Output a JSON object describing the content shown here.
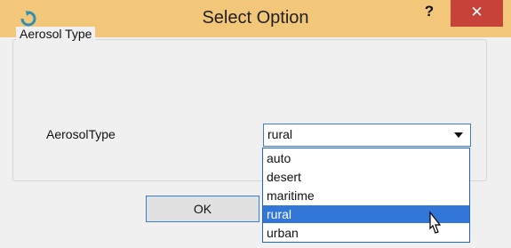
{
  "window": {
    "title": "Select Option",
    "help_label": "?",
    "close_label": "✕"
  },
  "group": {
    "title": "Aerosol Type"
  },
  "field": {
    "label": "AerosolType",
    "value": "rural"
  },
  "dropdown": {
    "options": [
      "auto",
      "desert",
      "maritime",
      "rural",
      "urban"
    ],
    "selected_index": 3
  },
  "buttons": {
    "ok_label": "OK"
  },
  "icons": {
    "app": "app-refresh-icon",
    "dropdown": "chevron-down-icon",
    "cursor": "mouse-pointer-icon"
  },
  "colors": {
    "titlebar": "#f3c77a",
    "close": "#c7433a",
    "selection": "#3277d7"
  }
}
